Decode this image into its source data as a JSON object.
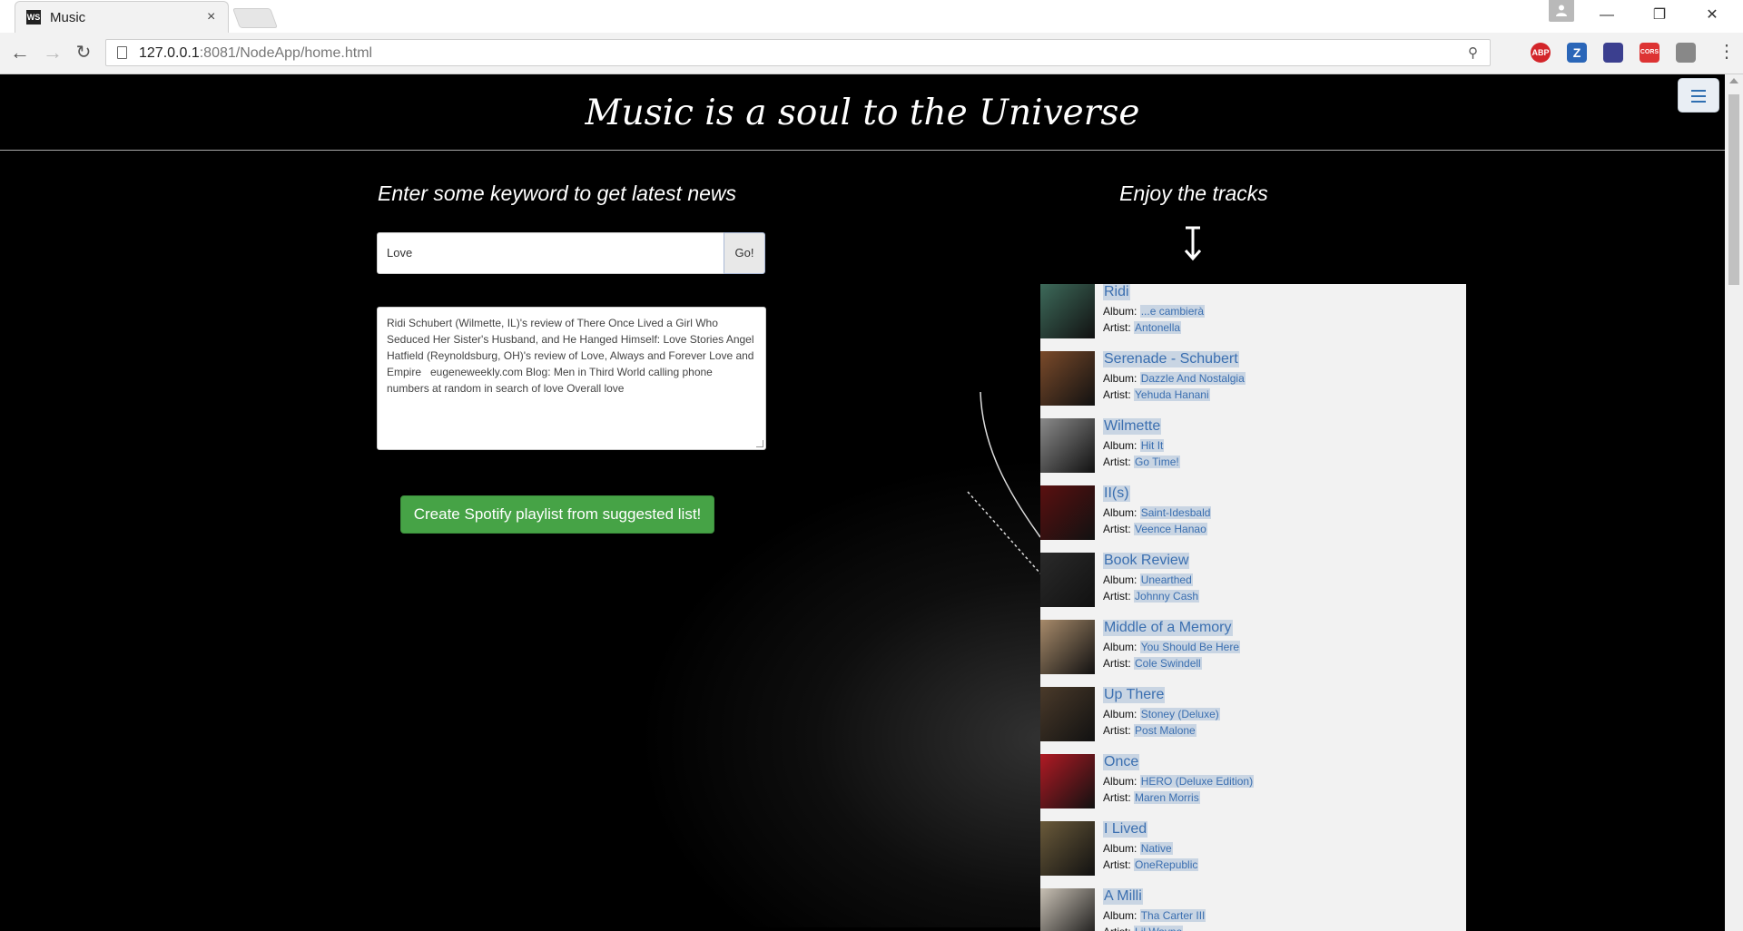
{
  "browser": {
    "tab_title": "Music",
    "tab_favicon_text": "WS",
    "tab_close": "×",
    "url_host": "127.0.0.1",
    "url_rest": ":8081/NodeApp/home.html",
    "extensions": [
      "ABP",
      "Z",
      "",
      "CORS",
      ""
    ],
    "win_minimize": "—",
    "win_restore": "❐",
    "win_close": "✕"
  },
  "page": {
    "site_title": "Music is a soul to the Universe",
    "left_heading": "Enter some keyword to get latest news",
    "search_value": "Love",
    "go_label": "Go!",
    "news_text": "Ridi Schubert (Wilmette, IL)'s review of There Once Lived a Girl Who Seduced Her Sister's Husband, and He Hanged Himself: Love Stories Angel Hatfield (Reynoldsburg, OH)'s review of Love, Always and Forever Love and Empire   eugeneweekly.com Blog: Men in Third World calling phone numbers at random in search of love Overall love",
    "spotify_button": "Create Spotify playlist from suggested list!",
    "right_heading": "Enjoy the tracks"
  },
  "labels": {
    "album": "Album:",
    "artist": "Artist:"
  },
  "tracks": [
    {
      "title": "Ridi",
      "album": "...e cambierà",
      "artist": "Antonella",
      "art_color": "#3d6a5a"
    },
    {
      "title": "Serenade - Schubert",
      "album": "Dazzle And Nostalgia",
      "artist": "Yehuda Hanani",
      "art_color": "#7a4a2a"
    },
    {
      "title": "Wilmette",
      "album": "Hit It",
      "artist": "Go Time!",
      "art_color": "#8a8a8a"
    },
    {
      "title": "II(s)",
      "album": "Saint-Idesbald",
      "artist": "Veence Hanao",
      "art_color": "#5a1010"
    },
    {
      "title": "Book Review",
      "album": "Unearthed",
      "artist": "Johnny Cash",
      "art_color": "#2a2a2a"
    },
    {
      "title": "Middle of a Memory",
      "album": "You Should Be Here",
      "artist": "Cole Swindell",
      "art_color": "#a78a6a"
    },
    {
      "title": "Up There",
      "album": "Stoney (Deluxe)",
      "artist": "Post Malone",
      "art_color": "#4a3a2a"
    },
    {
      "title": "Once",
      "album": "HERO (Deluxe Edition)",
      "artist": "Maren Morris",
      "art_color": "#b01a24"
    },
    {
      "title": "I Lived",
      "album": "Native",
      "artist": "OneRepublic",
      "art_color": "#6a5a3a"
    },
    {
      "title": "A Milli",
      "album": "Tha Carter III",
      "artist": "Lil Wayne",
      "art_color": "#c8c0b4"
    }
  ]
}
